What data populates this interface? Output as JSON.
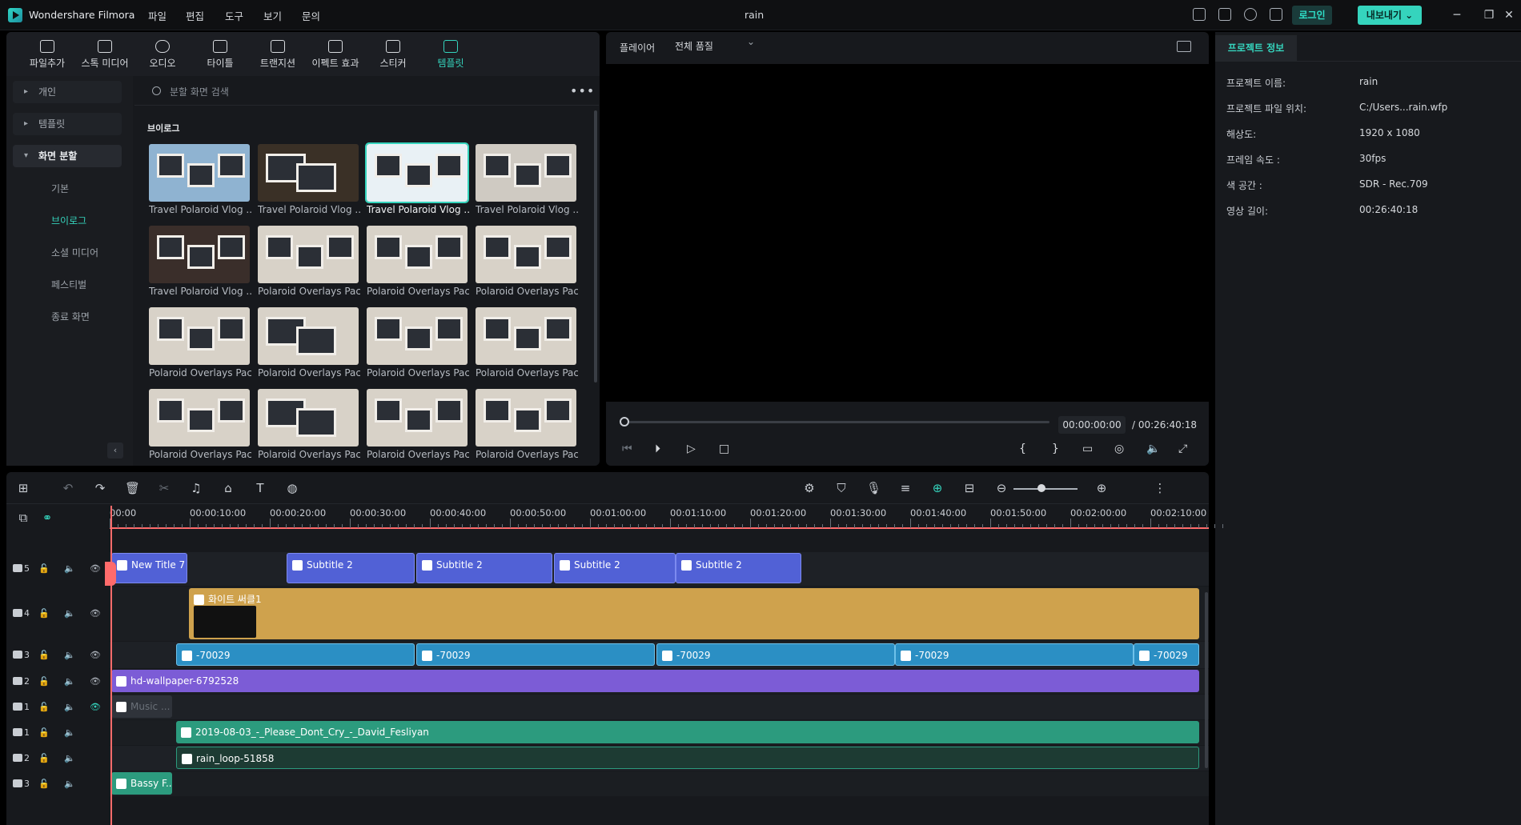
{
  "app": {
    "name": "Wondershare Filmora",
    "doc_title": "rain",
    "accent": "#35d4bd"
  },
  "menu": [
    "파일",
    "편집",
    "도구",
    "보기",
    "문의"
  ],
  "titlebar": {
    "login": "로그인",
    "export": "내보내기"
  },
  "media_tabs": [
    "파일추가",
    "스톡 미디어",
    "오디오",
    "타이틀",
    "트랜지션",
    "이펙트 효과",
    "스티커",
    "템플릿"
  ],
  "media_tabs_active": "템플릿",
  "side_nav": {
    "top": [
      "개인",
      "템플릿",
      "화면 분할"
    ],
    "sub": [
      "기본",
      "브이로그",
      "소셜 미디어",
      "페스티벌",
      "종료 화면"
    ],
    "active_sub": "브이로그"
  },
  "search": {
    "placeholder": "분할 화면 검색"
  },
  "section_title": "브이로그",
  "thumbs": [
    "Travel Polaroid Vlog ...",
    "Travel Polaroid Vlog ...",
    "Travel Polaroid Vlog ...",
    "Travel Polaroid Vlog ...",
    "Travel Polaroid Vlog ...",
    "Polaroid Overlays Pac...",
    "Polaroid Overlays Pac...",
    "Polaroid Overlays Pac...",
    "Polaroid Overlays Pac...",
    "Polaroid Overlays Pac...",
    "Polaroid Overlays Pac...",
    "Polaroid Overlays Pac...",
    "Polaroid Overlays Pac...",
    "Polaroid Overlays Pac...",
    "Polaroid Overlays Pac...",
    "Polaroid Overlays Pac..."
  ],
  "player": {
    "label": "플레이어",
    "quality": "전체 품질",
    "time_current": "00:00:00:00",
    "time_total": "/ 00:26:40:18",
    "progress": 0
  },
  "props": {
    "tab": "프로젝트 정보",
    "rows": [
      {
        "k": "프로젝트 이름:",
        "v": "rain"
      },
      {
        "k": "프로젝트 파일 위치:",
        "v": "C:/Users...rain.wfp"
      },
      {
        "k": "해상도:",
        "v": "1920 x 1080"
      },
      {
        "k": "프레임 속도 :",
        "v": "30fps"
      },
      {
        "k": "색 공간 :",
        "v": "SDR - Rec.709"
      },
      {
        "k": "영상 길이:",
        "v": "00:26:40:18"
      }
    ]
  },
  "ruler": [
    "00:00",
    "00:00:10:00",
    "00:00:20:00",
    "00:00:30:00",
    "00:00:40:00",
    "00:00:50:00",
    "00:01:00:00",
    "00:01:10:00",
    "00:01:20:00",
    "00:01:30:00",
    "00:01:40:00",
    "00:01:50:00",
    "00:02:00:00",
    "00:02:10:00"
  ],
  "tracks": {
    "labels": [
      "5",
      "4",
      "3",
      "2",
      "1",
      "1",
      "2",
      "3"
    ],
    "title_clips": [
      "New Title 7",
      "Subtitle 2",
      "Subtitle 2",
      "Subtitle 2",
      "Subtitle 2"
    ],
    "template_clip": "화이트 써클1",
    "video_clips": [
      "-70029",
      "-70029",
      "-70029",
      "-70029",
      "-70029"
    ],
    "image_clip": "hd-wallpaper-6792528",
    "muted_clip": "Music ...",
    "audio1": "2019-08-03_-_Please_Dont_Cry_-_David_Fesliyan",
    "audio2": "rain_loop-51858",
    "audio3": "Bassy F..."
  }
}
